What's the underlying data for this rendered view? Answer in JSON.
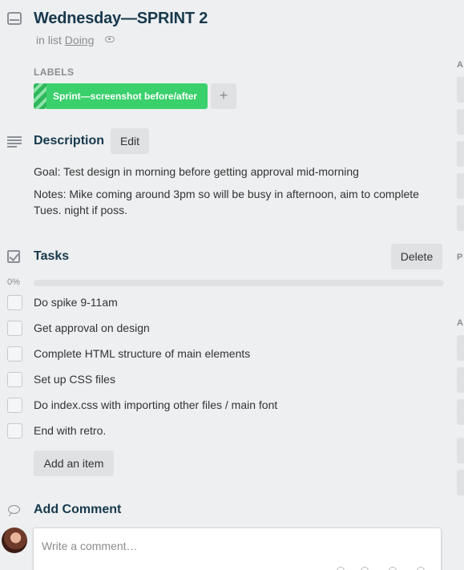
{
  "card": {
    "title": "Wednesday—SPRINT 2",
    "in_list_prefix": "in list",
    "list_name": "Doing"
  },
  "labels": {
    "caption": "LABELS",
    "items": [
      {
        "text": "Sprint—screenshot before/after",
        "color": "#3ad06b"
      }
    ],
    "add_symbol": "+"
  },
  "description": {
    "title": "Description",
    "edit_label": "Edit",
    "paragraphs": [
      "Goal: Test design in morning before getting approval mid-morning",
      "Notes: Mike coming around 3pm so will be busy in afternoon, aim to complete Tues. night if poss."
    ]
  },
  "tasks": {
    "title": "Tasks",
    "delete_label": "Delete",
    "progress_label": "0%",
    "progress_value": 0,
    "items": [
      {
        "text": "Do spike 9-11am",
        "checked": false
      },
      {
        "text": "Get approval on design",
        "checked": false
      },
      {
        "text": "Complete HTML structure of main elements",
        "checked": false
      },
      {
        "text": "Set up CSS files",
        "checked": false
      },
      {
        "text": "Do index.css with importing other files / main font",
        "checked": false
      },
      {
        "text": "End with retro.",
        "checked": false
      }
    ],
    "add_item_label": "Add an item"
  },
  "comment": {
    "title": "Add Comment",
    "placeholder": "Write a comment…"
  },
  "sidebar": {
    "captions": [
      "A",
      "P",
      "A"
    ]
  },
  "colors": {
    "title": "#17394d",
    "label_green": "#3ad06b",
    "button_gray": "#dfe1e3",
    "background": "#edeff0"
  }
}
